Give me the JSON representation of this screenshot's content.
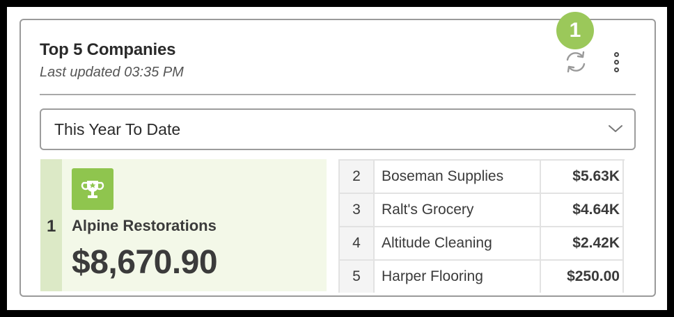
{
  "widget": {
    "title": "Top 5 Companies",
    "last_updated": "Last updated 03:35 PM",
    "badge": "1",
    "period": "This Year To Date",
    "accent_color": "#9bc85a"
  },
  "leader": {
    "rank": "1",
    "name": "Alpine Restorations",
    "amount": "$8,670.90"
  },
  "rankings": [
    {
      "rank": "2",
      "name": "Boseman Supplies",
      "value": "$5.63K"
    },
    {
      "rank": "3",
      "name": "Ralt's Grocery",
      "value": "$4.64K"
    },
    {
      "rank": "4",
      "name": "Altitude Cleaning",
      "value": "$2.42K"
    },
    {
      "rank": "5",
      "name": "Harper Flooring",
      "value": "$250.00"
    }
  ],
  "icons": {
    "refresh": "refresh-icon",
    "menu": "more-vertical-icon",
    "dropdown": "chevron-down-icon",
    "trophy": "trophy-icon"
  }
}
